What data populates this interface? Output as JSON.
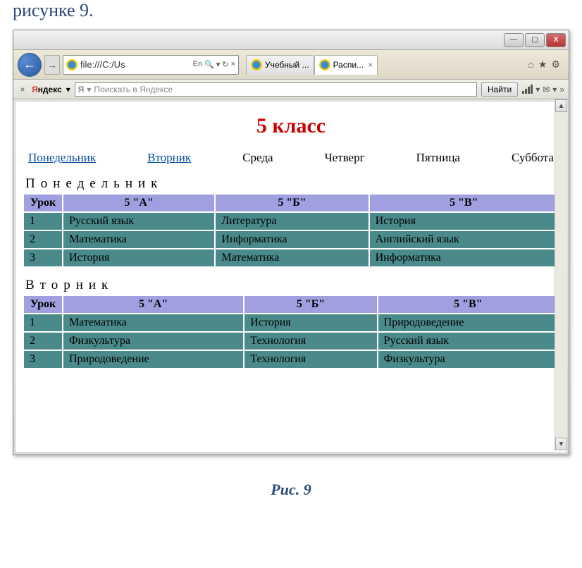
{
  "outer_text": "рисунке 9.",
  "caption": "Рис. 9",
  "window": {
    "minimize": "—",
    "maximize": "▢",
    "close": "X"
  },
  "nav": {
    "back": "←",
    "forward": "→",
    "url": "file:///C:/Us",
    "lang": "En",
    "search_glyph": "🔍",
    "reload": "↻",
    "stop": "×"
  },
  "tabs": [
    {
      "title": "Учебный ..."
    },
    {
      "title": "Распи...",
      "closable": true
    }
  ],
  "toolbar_icons": [
    "home",
    "star",
    "gear"
  ],
  "yandex": {
    "logo_y": "Я",
    "logo_text": "ндекс",
    "dropdown": "▾",
    "search_y": "Я",
    "placeholder": "Поискать в Яндексе",
    "find": "Найти",
    "more": "»"
  },
  "page": {
    "title": "5 класс",
    "days_nav": [
      {
        "label": "Понедельник",
        "link": true
      },
      {
        "label": "Вторник",
        "link": true
      },
      {
        "label": "Среда",
        "link": false
      },
      {
        "label": "Четверг",
        "link": false
      },
      {
        "label": "Пятница",
        "link": false
      },
      {
        "label": "Суббота",
        "link": false
      }
    ],
    "columns": [
      "Урок",
      "5 \"А\"",
      "5 \"Б\"",
      "5 \"В\""
    ],
    "sections": [
      {
        "day": "Понедельник",
        "rows": [
          [
            "1",
            "Русский язык",
            "Литература",
            "История"
          ],
          [
            "2",
            "Математика",
            "Информатика",
            "Английский язык"
          ],
          [
            "3",
            "История",
            "Математика",
            "Информатика"
          ]
        ]
      },
      {
        "day": "Вторник",
        "rows": [
          [
            "1",
            "Математика",
            "История",
            "Природоведение"
          ],
          [
            "2",
            "Физкультура",
            "Технология",
            "Русский язык"
          ],
          [
            "3",
            "Природоведение",
            "Технология",
            "Физкультура"
          ]
        ]
      }
    ]
  }
}
